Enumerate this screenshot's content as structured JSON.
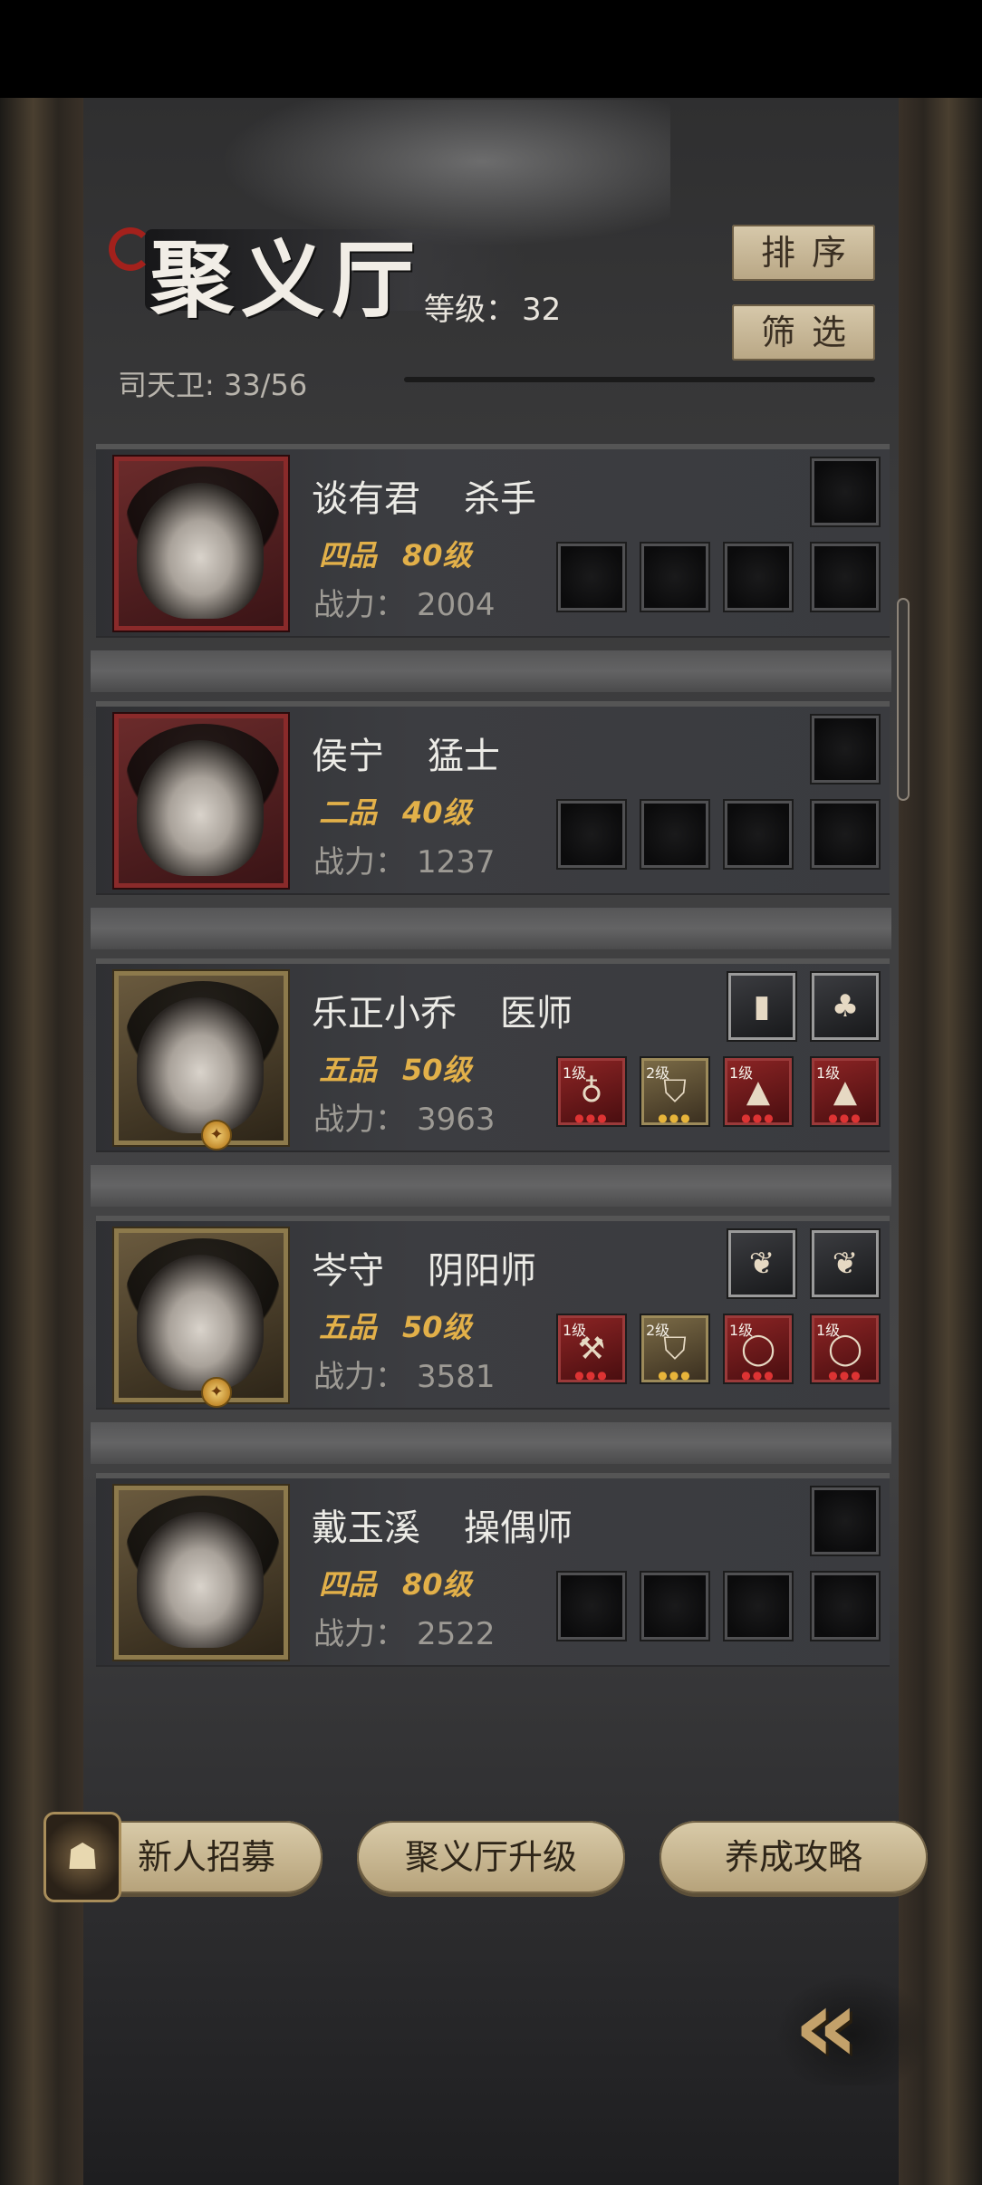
{
  "header": {
    "title": "聚义厅",
    "level_label": "等级：",
    "level_value": "32",
    "guard_count": "司天卫: 33/56",
    "sort_button": "排序",
    "filter_button": "筛选"
  },
  "heroes": [
    {
      "name": "谈有君",
      "role": "杀手",
      "rank": "四品",
      "level": "80级",
      "power_label": "战力：",
      "power": "2004",
      "frame": "red"
    },
    {
      "name": "侯宁",
      "role": "猛士",
      "rank": "二品",
      "level": "40级",
      "power_label": "战力：",
      "power": "1237",
      "frame": "red"
    },
    {
      "name": "乐正小乔",
      "role": "医师",
      "rank": "五品",
      "level": "50级",
      "power_label": "战力：",
      "power": "3963",
      "frame": "gold",
      "equip": [
        {
          "tag": "1级",
          "icon": "gourd-icon"
        },
        {
          "tag": "2级",
          "icon": "armor-icon"
        },
        {
          "tag": "1级",
          "icon": "cloth-icon"
        },
        {
          "tag": "1级",
          "icon": "cloth-icon"
        }
      ]
    },
    {
      "name": "岑守",
      "role": "阴阳师",
      "rank": "五品",
      "level": "50级",
      "power_label": "战力：",
      "power": "3581",
      "frame": "gold",
      "equip": [
        {
          "tag": "1级",
          "icon": "axe-icon"
        },
        {
          "tag": "2级",
          "icon": "armor-icon"
        },
        {
          "tag": "1级",
          "icon": "bracelet-icon"
        },
        {
          "tag": "1级",
          "icon": "bracelet-icon"
        }
      ]
    },
    {
      "name": "戴玉溪",
      "role": "操偶师",
      "rank": "四品",
      "level": "80级",
      "power_label": "战力：",
      "power": "2522",
      "frame": "gold"
    }
  ],
  "footer": {
    "recruit_button": "新人招募",
    "upgrade_button": "聚义厅升级",
    "guide_button": "养成攻略"
  },
  "colors": {
    "rank_gold": "#e2b049",
    "button_tan": "#d7c9ab",
    "red_frame": "#8a2a2a",
    "gold_frame": "#8d7a4c"
  }
}
